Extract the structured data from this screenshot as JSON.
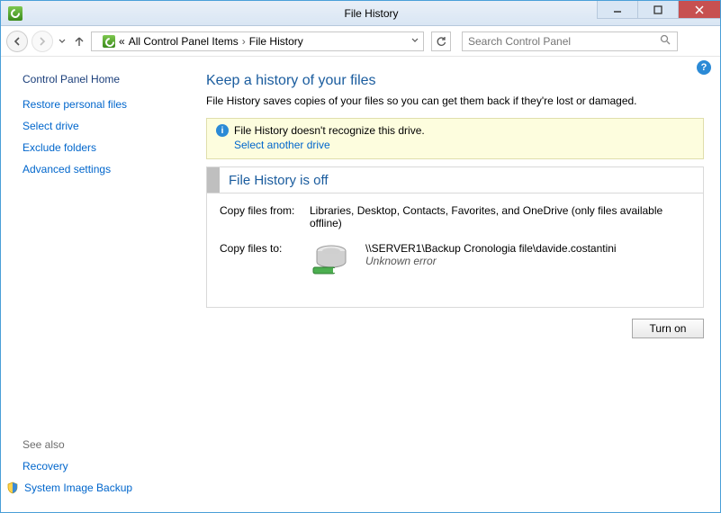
{
  "title": "File History",
  "breadcrumb": {
    "prefix": "«",
    "part1": "All Control Panel Items",
    "part2": "File History"
  },
  "search": {
    "placeholder": "Search Control Panel"
  },
  "sidebar": {
    "head": "Control Panel Home",
    "links": [
      "Restore personal files",
      "Select drive",
      "Exclude folders",
      "Advanced settings"
    ],
    "see_also": "See also",
    "recovery": "Recovery",
    "system_image": "System Image Backup"
  },
  "main": {
    "heading": "Keep a history of your files",
    "subheading": "File History saves copies of your files so you can get them back if they're lost or damaged.",
    "info_text": "File History doesn't recognize this drive.",
    "info_link": "Select another drive",
    "status_title": "File History is off",
    "from_label": "Copy files from:",
    "from_value": "Libraries, Desktop, Contacts, Favorites, and OneDrive (only files available offline)",
    "to_label": "Copy files to:",
    "to_value": "\\\\SERVER1\\Backup Cronologia file\\davide.costantini",
    "to_error": "Unknown error",
    "turn_on": "Turn on"
  }
}
